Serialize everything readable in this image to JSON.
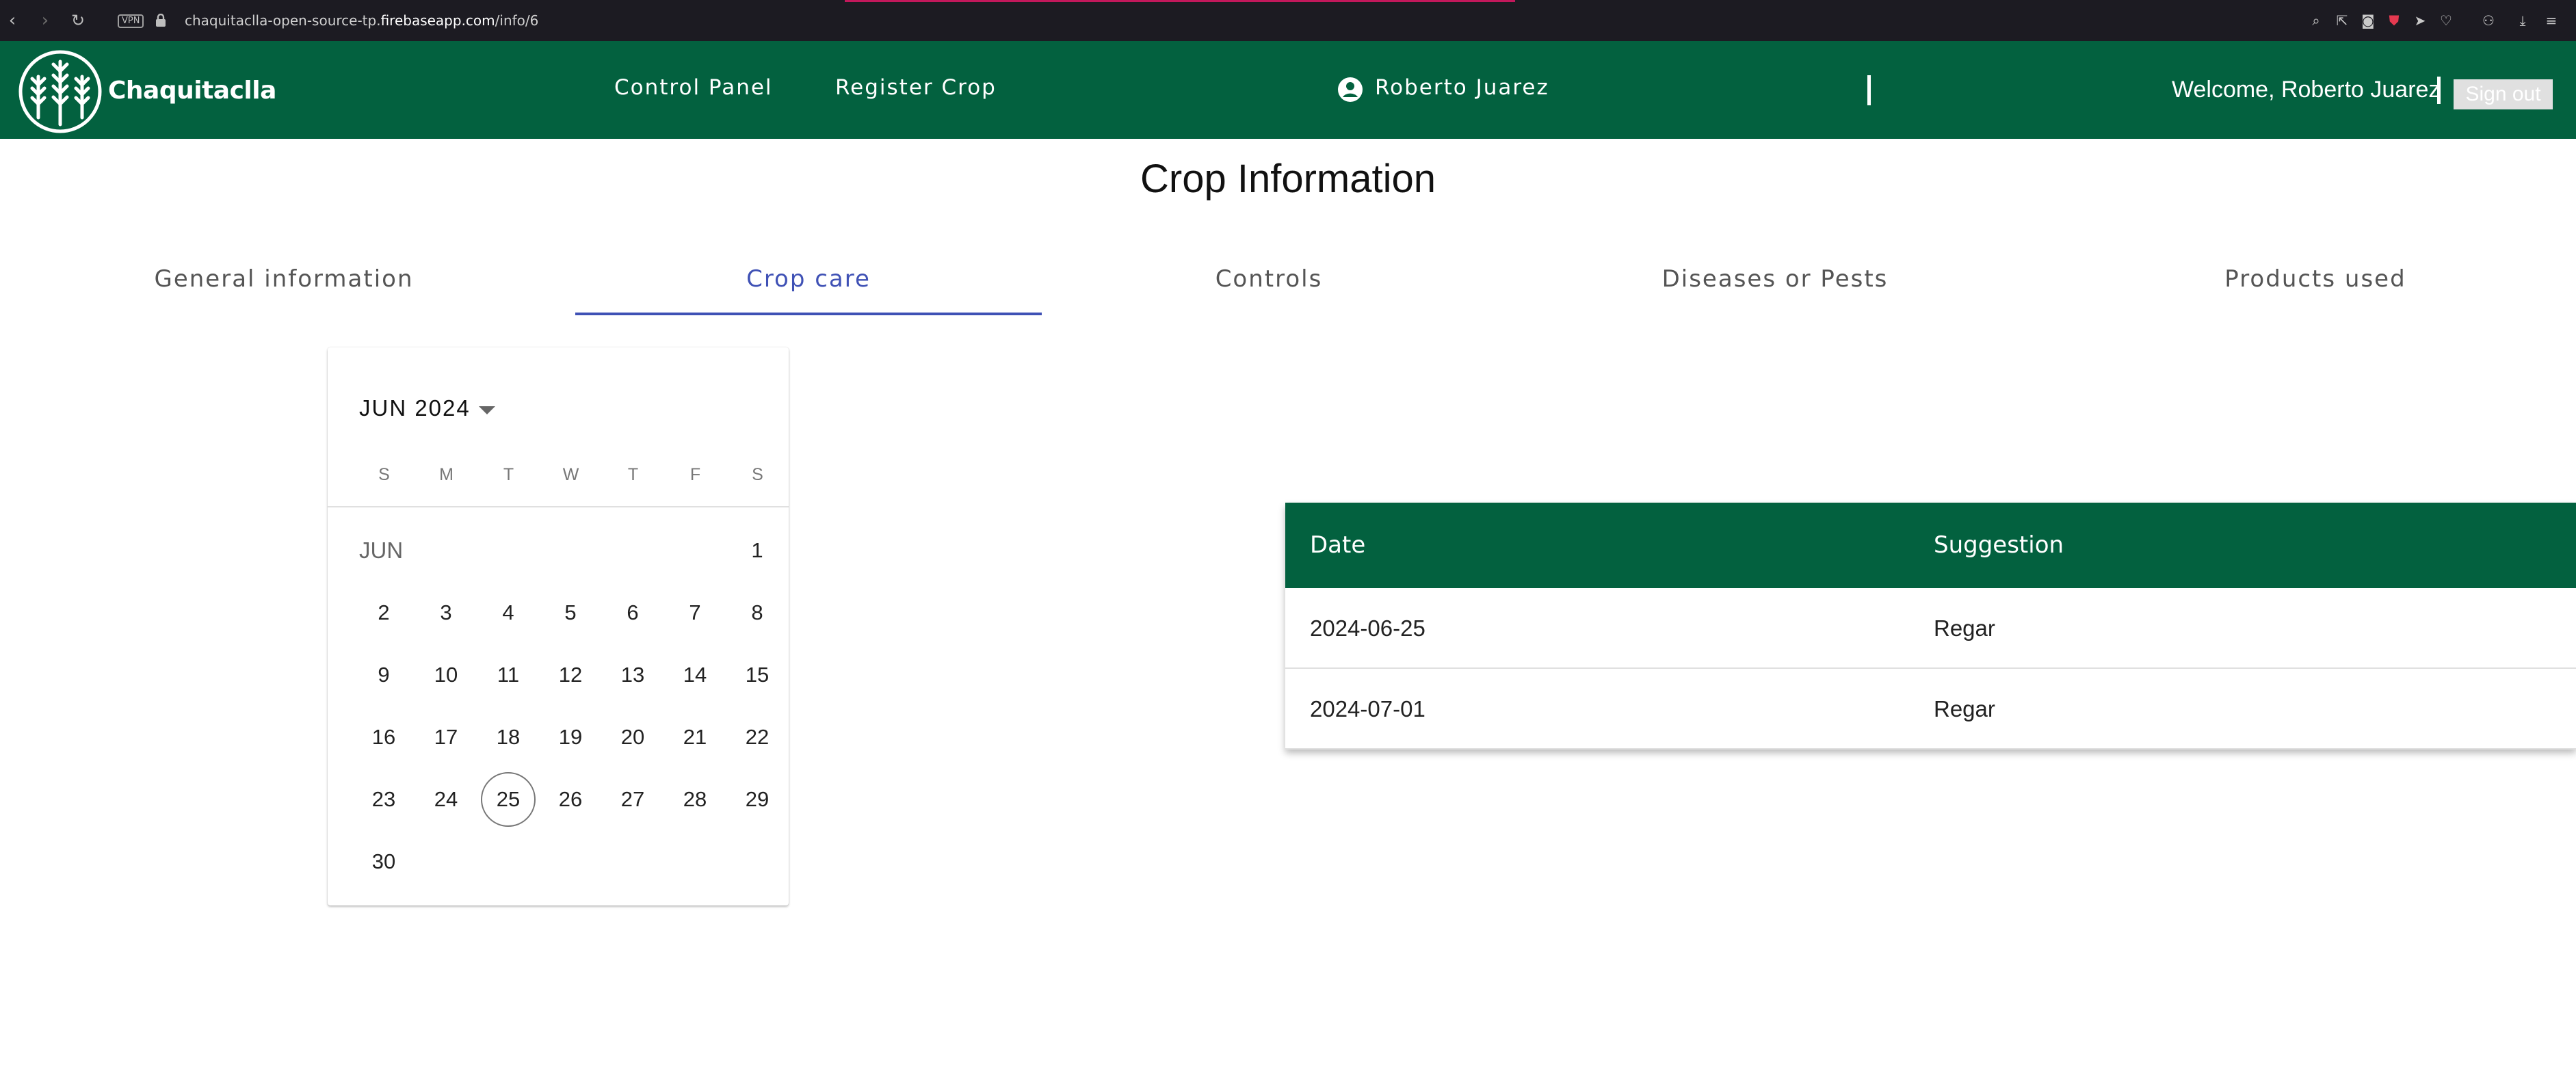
{
  "browser": {
    "url_prefix": "chaquitaclla-open-source-tp.",
    "url_host": "firebaseapp.com",
    "url_path": "/info/6",
    "vpn_label": "VPN"
  },
  "header": {
    "brand": "Chaquitaclla",
    "nav": [
      "Control Panel",
      "Register Crop"
    ],
    "user_name": "Roberto Juarez",
    "welcome": "Welcome, Roberto Juarez",
    "signout_label": "Sign out",
    "colors": {
      "primary": "#03613f"
    }
  },
  "page": {
    "title": "Crop Information"
  },
  "tabs": [
    {
      "label": "General information",
      "active": false
    },
    {
      "label": "Crop care",
      "active": true
    },
    {
      "label": "Controls",
      "active": false
    },
    {
      "label": "Diseases or Pests",
      "active": false
    },
    {
      "label": "Products used",
      "active": false
    }
  ],
  "calendar": {
    "period_label": "JUN 2024",
    "weekdays": [
      "S",
      "M",
      "T",
      "W",
      "T",
      "F",
      "S"
    ],
    "month_label": "JUN",
    "days": [
      "1",
      "2",
      "3",
      "4",
      "5",
      "6",
      "7",
      "8",
      "9",
      "10",
      "11",
      "12",
      "13",
      "14",
      "15",
      "16",
      "17",
      "18",
      "19",
      "20",
      "21",
      "22",
      "23",
      "24",
      "25",
      "26",
      "27",
      "28",
      "29",
      "30"
    ],
    "first_weekday_index": 6,
    "highlighted_day": "25"
  },
  "suggestions_table": {
    "headers": [
      "Date",
      "Suggestion"
    ],
    "rows": [
      [
        "2024-06-25",
        "Regar"
      ],
      [
        "2024-07-01",
        "Regar"
      ]
    ]
  }
}
